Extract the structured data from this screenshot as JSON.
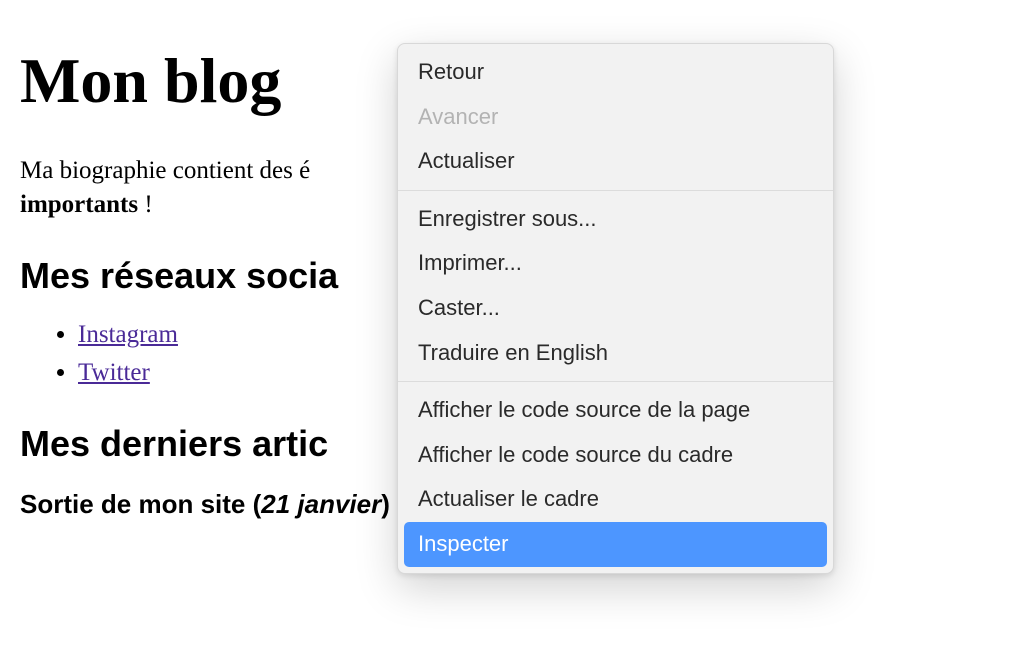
{
  "header": {
    "title": "Mon blog"
  },
  "bio": {
    "text_prefix": "Ma biographie contient des é",
    "bold_word": "importants",
    "after_bold": " !"
  },
  "sections": {
    "social_heading": "Mes réseaux socia",
    "articles_heading": "Mes derniers artic"
  },
  "socials": [
    {
      "label": "Instagram"
    },
    {
      "label": "Twitter"
    }
  ],
  "article": {
    "title_prefix": "Sortie de mon site (",
    "date": "21 janvier",
    "title_suffix": ")"
  },
  "context_menu": {
    "items": [
      {
        "label": "Retour",
        "enabled": true
      },
      {
        "label": "Avancer",
        "enabled": false
      },
      {
        "label": "Actualiser",
        "enabled": true
      },
      {
        "sep": true
      },
      {
        "label": "Enregistrer sous...",
        "enabled": true
      },
      {
        "label": "Imprimer...",
        "enabled": true
      },
      {
        "label": "Caster...",
        "enabled": true
      },
      {
        "label": "Traduire en English",
        "enabled": true
      },
      {
        "sep": true
      },
      {
        "label": "Afficher le code source de la page",
        "enabled": true
      },
      {
        "label": "Afficher le code source du cadre",
        "enabled": true
      },
      {
        "label": "Actualiser le cadre",
        "enabled": true
      },
      {
        "label": "Inspecter",
        "enabled": true,
        "highlight": true
      }
    ]
  }
}
